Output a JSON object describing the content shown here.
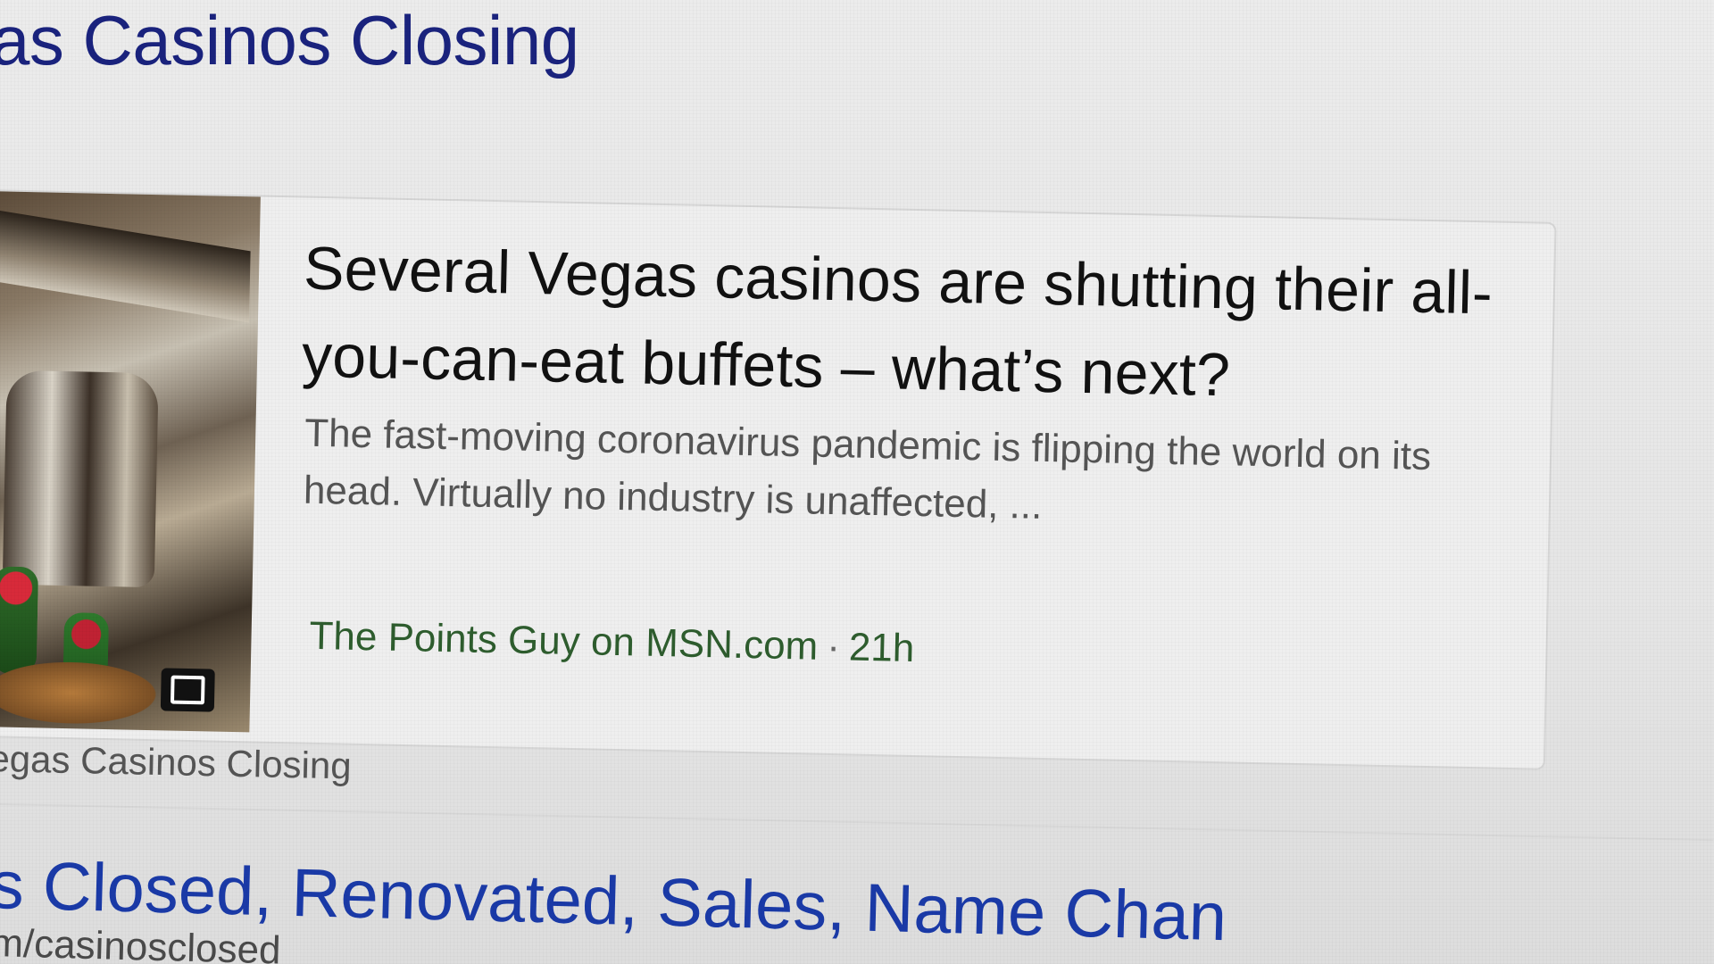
{
  "header": {
    "heading": "as Casinos Closing"
  },
  "news_card": {
    "title": "Several Vegas casinos are shutting their all-you-can-eat buffets – what’s next?",
    "snippet": "The fast-moving coronavirus pandemic is flipping the world on its head. Virtually no industry is unaffected, ...",
    "source": "The Points Guy on MSN.com",
    "separator": "·",
    "age": "21h",
    "thumbnail_icon": "video-icon"
  },
  "caption": "egas Casinos Closing",
  "result": {
    "title": "s Closed, Renovated, Sales, Name Chan",
    "url": "m/casinosclosed"
  }
}
